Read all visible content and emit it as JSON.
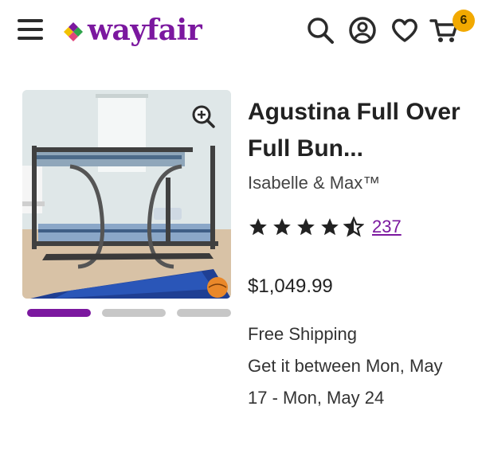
{
  "header": {
    "logo_text": "wayfair",
    "icons": [
      "menu-icon",
      "search-icon",
      "account-icon",
      "heart-icon",
      "cart-icon"
    ],
    "cart_count": "6"
  },
  "gallery": {
    "image_alt": "bunk bed photo",
    "images_count": 3,
    "active_index": 0
  },
  "product": {
    "title": "Agustina Full Over Full Bun...",
    "brand": "Isabelle & Max™",
    "rating": 4.5,
    "review_count": "237",
    "price": "$1,049.99",
    "shipping": "Free Shipping",
    "delivery": "Get it between Mon, May 17 - Mon, May 24"
  },
  "colors": {
    "brand_purple": "#7b189f",
    "badge_yellow": "#f2a900",
    "dot_inactive": "#c7c7c7"
  }
}
